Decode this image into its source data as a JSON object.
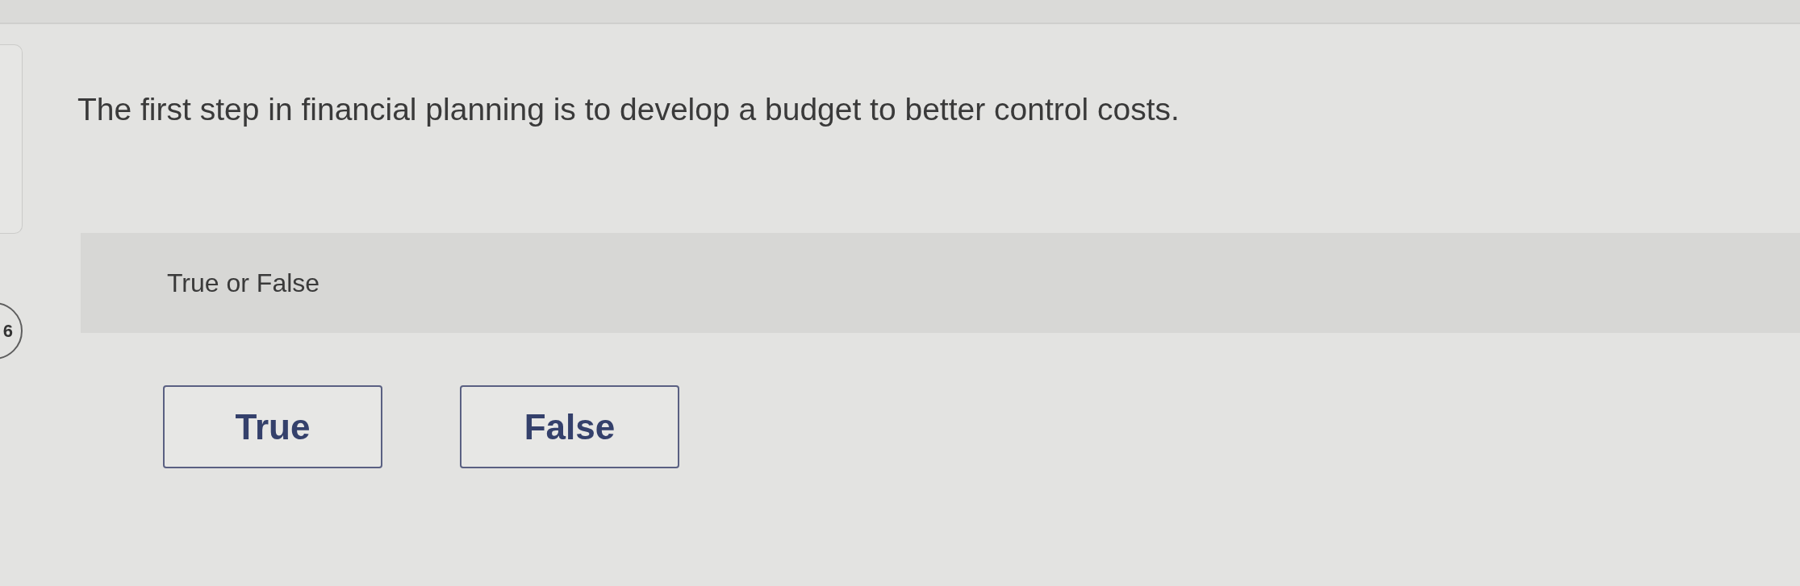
{
  "question_number": "6",
  "question": {
    "text": "The first step in financial planning is to develop a budget to better control costs."
  },
  "prompt": "True or False",
  "options": [
    {
      "label": "True",
      "selected": false
    },
    {
      "label": "False",
      "selected": false
    }
  ]
}
